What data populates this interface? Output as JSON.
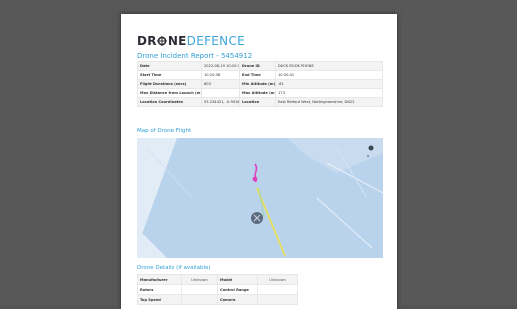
{
  "logo": {
    "part1": "DR",
    "part2": "NE",
    "part3": "DEFENCE"
  },
  "report": {
    "title": "Drone Incident Report - 5454912"
  },
  "info_rows": [
    [
      {
        "label": "Date",
        "value": "2022-08-19 10:20:38"
      },
      {
        "label": "Drone ID",
        "value": "DUCK ROOK PHONE"
      }
    ],
    [
      {
        "label": "Start Time",
        "value": "10:20:38"
      },
      {
        "label": "End Time",
        "value": "10:30:41"
      }
    ],
    [
      {
        "label": "Flight Durations (secs)",
        "value": "603"
      },
      {
        "label": "Min Altitude (m)",
        "value": "-61"
      }
    ],
    [
      {
        "label": "Max Distance from Launch (m)",
        "value": ""
      },
      {
        "label": "Max Altitude (m)",
        "value": "173"
      }
    ],
    [
      {
        "label": "Location Coordinates",
        "value": "53.234421, -0.901699"
      },
      {
        "label": "Location",
        "value": "East Retford West, Nottinghamshire, DN22"
      }
    ]
  ],
  "map": {
    "heading": "Map of Drone Flight",
    "compass_label": "N"
  },
  "details": {
    "heading": "Drone Details (if available)",
    "rows": [
      [
        {
          "label": "Manufacturer",
          "value": "Unknown"
        },
        {
          "label": "Model",
          "value": "Unknown"
        }
      ],
      [
        {
          "label": "Rotors",
          "value": ""
        },
        {
          "label": "Control Range",
          "value": ""
        }
      ],
      [
        {
          "label": "Top Speed",
          "value": ""
        },
        {
          "label": "Camera",
          "value": ""
        }
      ]
    ]
  },
  "colors": {
    "accent": "#2f9fd6",
    "map_water": "#b9d3ec",
    "flight_path": "#e8e060",
    "launch_path": "#e040c0",
    "marker": "#5c6b80"
  }
}
